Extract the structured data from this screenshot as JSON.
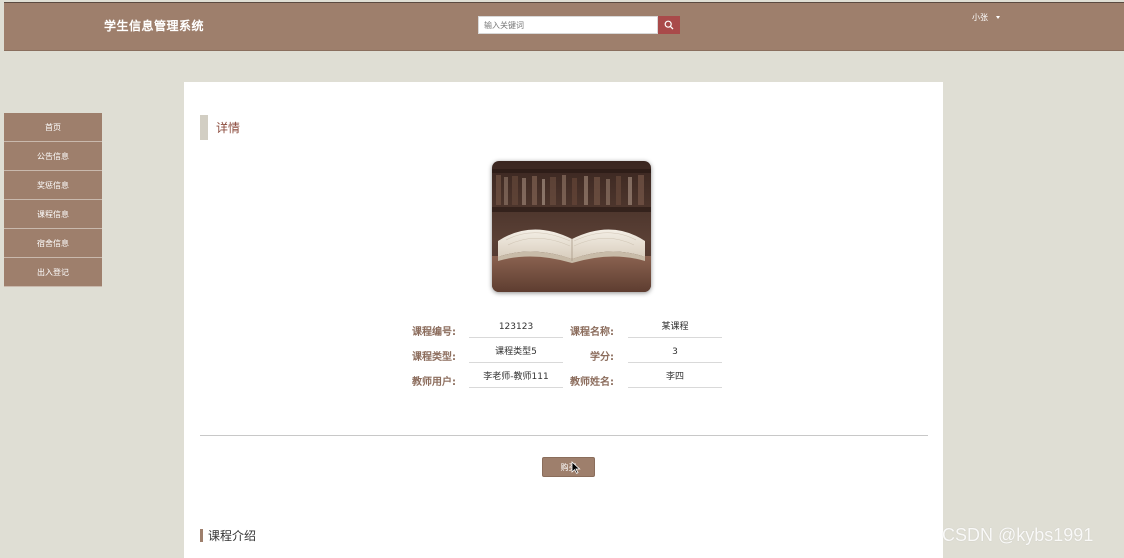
{
  "header": {
    "brand": "学生信息管理系统",
    "search_placeholder": "输入关键词",
    "search_icon": "search-icon",
    "username": "小张"
  },
  "sidebar": {
    "items": [
      {
        "label": "首页"
      },
      {
        "label": "公告信息"
      },
      {
        "label": "奖惩信息"
      },
      {
        "label": "课程信息"
      },
      {
        "label": "宿舍信息"
      },
      {
        "label": "出入登记"
      }
    ]
  },
  "detail": {
    "section_title": "详情",
    "image_desc": "open-book-photo",
    "fields": {
      "course_no_label": "课程编号:",
      "course_no_value": "123123",
      "course_name_label": "课程名称:",
      "course_name_value": "某课程",
      "course_type_label": "课程类型:",
      "course_type_value": "课程类型5",
      "credit_label": "学分:",
      "credit_value": "3",
      "teacher_user_label": "教师用户:",
      "teacher_user_value": "李老师-教师111",
      "teacher_name_label": "教师姓名:",
      "teacher_name_value": "李四"
    },
    "buy_button": "购买"
  },
  "intro": {
    "section_title": "课程介绍"
  },
  "watermark": "CSDN @kybs1991",
  "colors": {
    "accent": "#9e7f6c",
    "search_button": "#a94a4a",
    "page_background": "#dfded4"
  }
}
